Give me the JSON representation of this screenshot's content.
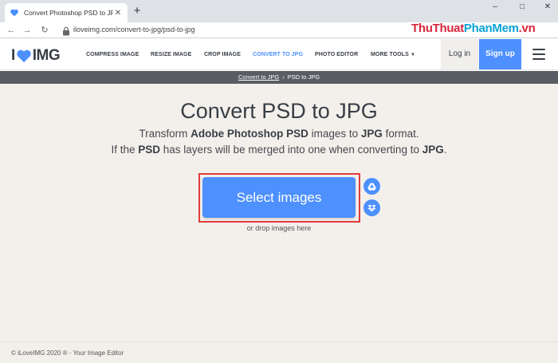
{
  "browser": {
    "tab_title": "Convert Photoshop PSD to JPG",
    "tab_close": "✕",
    "new_tab": "+",
    "url": "iloveimg.com/convert-to-jpg/psd-to-jpg",
    "window_controls": [
      "–",
      "□",
      "✕"
    ],
    "watermark_part1": "ThuThuat",
    "watermark_part2": "PhanMem",
    "watermark_part3": ".vn"
  },
  "header": {
    "logo_left": "I",
    "logo_right": "IMG",
    "nav": [
      {
        "label": "COMPRESS IMAGE"
      },
      {
        "label": "RESIZE IMAGE"
      },
      {
        "label": "CROP IMAGE"
      },
      {
        "label": "CONVERT TO JPG"
      },
      {
        "label": "PHOTO EDITOR"
      },
      {
        "label": "MORE TOOLS"
      }
    ],
    "login": "Log in",
    "signup": "Sign up"
  },
  "breadcrumb": {
    "parent": "Convert to JPG",
    "separator": "›",
    "current": "PSD to JPG"
  },
  "main": {
    "title": "Convert PSD to JPG",
    "sub1_a": "Transform ",
    "sub1_b": "Adobe Photoshop PSD",
    "sub1_c": " images to ",
    "sub1_d": "JPG",
    "sub1_e": " format.",
    "sub2_a": "If the ",
    "sub2_b": "PSD",
    "sub2_c": " has layers will be merged into one when converting to ",
    "sub2_d": "JPG",
    "sub2_e": ".",
    "select_button": "Select images",
    "drop_hint": "or drop images here"
  },
  "footer": {
    "text": "© iLoveIMG 2020 ® - Your Image Editor"
  },
  "colors": {
    "accent": "#4d90fe",
    "highlight_box": "#e03b3b",
    "page_bg": "#f3f0ec",
    "crumb_bg": "#5a5d63"
  }
}
